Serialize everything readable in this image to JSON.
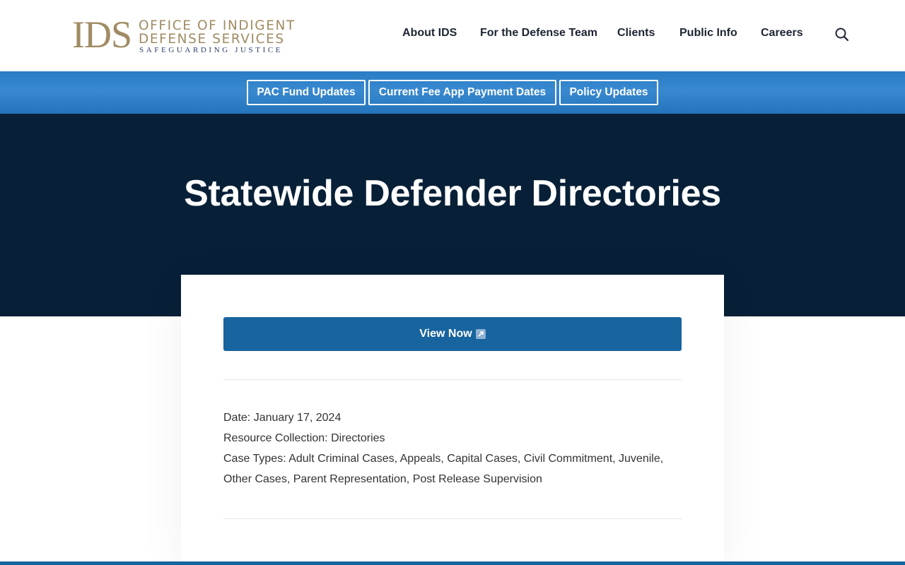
{
  "header": {
    "logo": {
      "mark": "IDS",
      "line1": "OFFICE OF INDIGENT",
      "line2": "DEFENSE SERVICES",
      "tagline": "SAFEGUARDING JUSTICE"
    },
    "nav": [
      {
        "label": "About IDS"
      },
      {
        "label": "For the Defense Team"
      },
      {
        "label": "Clients"
      },
      {
        "label": "Public Info"
      },
      {
        "label": "Careers"
      }
    ],
    "search_icon": "search-icon"
  },
  "alert_bar": {
    "buttons": [
      {
        "label": "PAC Fund Updates"
      },
      {
        "label": "Current Fee App Payment Dates"
      },
      {
        "label": "Policy Updates"
      }
    ]
  },
  "hero": {
    "title": "Statewide Defender Directories"
  },
  "resource": {
    "view_button": {
      "label": "View Now",
      "icon": "external-link-icon"
    },
    "date": "Date: January 17, 2024",
    "collection": "Resource Collection: Directories",
    "case_types": "Case Types: Adult Criminal Cases, Appeals, Capital Cases, Civil Commitment, Juvenile, Other Cases, Parent Representation, Post Release Supervision"
  },
  "colors": {
    "logo_gold": "#a08b63",
    "hero_navy": "#082037",
    "alert_blue": "#2a7cc4",
    "button_blue": "#17649f"
  }
}
